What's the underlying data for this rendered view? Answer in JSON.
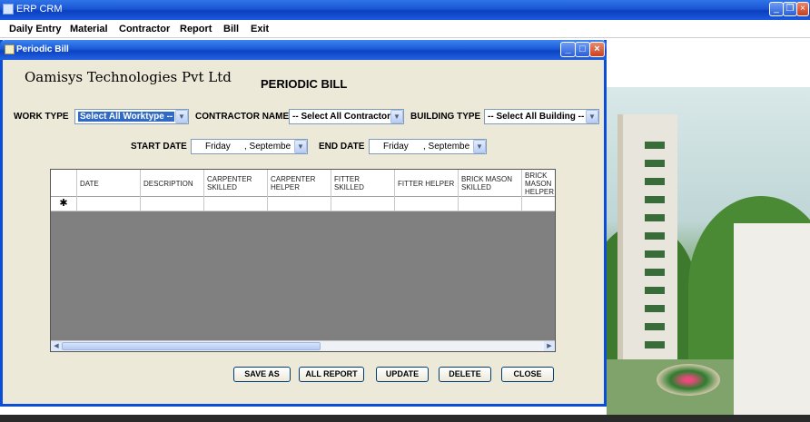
{
  "window": {
    "title": "ERP CRM"
  },
  "menu": [
    "Daily Entry",
    "Material",
    "Contractor",
    "Report",
    "Bill",
    "Exit"
  ],
  "dialog": {
    "title": "Periodic Bill",
    "company": "Oamisys Technologies Pvt Ltd",
    "heading": "PERIODIC BILL"
  },
  "filters": {
    "work_type_label": "WORK TYPE",
    "work_type_value": "Select All Worktype --",
    "contractor_label": "CONTRACTOR NAME",
    "contractor_value": "-- Select All Contractor",
    "building_label": "BUILDING TYPE",
    "building_value": "-- Select All Building --",
    "start_date_label": "START DATE",
    "start_date_day": "Friday",
    "start_date_month": ", Septembe",
    "end_date_label": "END DATE",
    "end_date_day": "Friday",
    "end_date_month": ", Septembe"
  },
  "grid": {
    "columns": [
      "DATE",
      "DESCRIPTION",
      "CARPENTER SKILLED",
      "CARPENTER HELPER",
      "FITTER SKILLED",
      "FITTER HELPER",
      "BRICK MASON SKILLED",
      "BRICK MASON HELPER"
    ],
    "new_row_marker": "✱"
  },
  "buttons": {
    "save_as": "SAVE AS",
    "all_report": "ALL REPORT",
    "update": "UPDATE",
    "delete": "DELETE",
    "close": "CLOSE"
  },
  "icons": [
    "app-icon",
    "minimize-icon",
    "restore-icon",
    "close-icon",
    "dropdown-arrow-icon",
    "scroll-left-icon",
    "scroll-right-icon"
  ],
  "colors": {
    "titlebar": "#1a55d4",
    "dialog_bg": "#ece9d8",
    "grid_bg": "#808080",
    "selection": "#316ac5"
  }
}
